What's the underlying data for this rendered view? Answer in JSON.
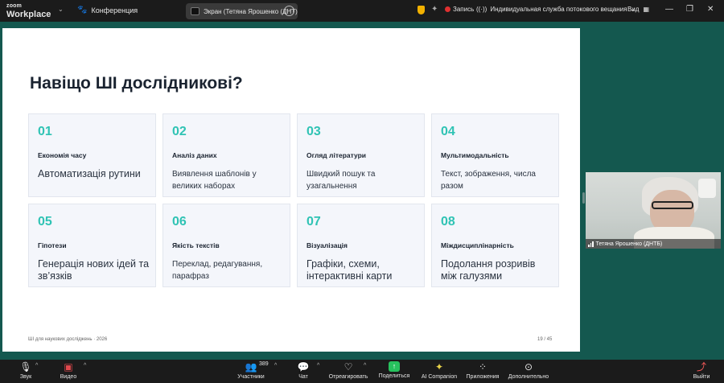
{
  "top_bar": {
    "brand_small": "zoom",
    "brand_large": "Workplace",
    "conference_label": "Конференция",
    "share_label": "Экран (Тетяна Ярошенко (ДНТ)",
    "record_label": "Запись",
    "stream_label": "Индивидуальная служба потокового вещания",
    "view_label": "Вид"
  },
  "slide": {
    "title": "Навіщо ШІ дослідникові?",
    "cards": [
      {
        "num": "01",
        "title": "Економія часу",
        "desc": "Автоматизація рутини",
        "size": "large"
      },
      {
        "num": "02",
        "title": "Аналіз даних",
        "desc": "Виявлення шаблонів у великих наборах",
        "size": "small"
      },
      {
        "num": "03",
        "title": "Огляд літератури",
        "desc": "Швидкий пошук та узагальнення",
        "size": "small"
      },
      {
        "num": "04",
        "title": "Мультимодальність",
        "desc": "Текст, зображення, числа разом",
        "size": "small"
      },
      {
        "num": "05",
        "title": "Гіпотези",
        "desc": "Генерація нових ідей та зв’язків",
        "size": "large"
      },
      {
        "num": "06",
        "title": "Якість текстів",
        "desc": "Переклад, редагування, парафраз",
        "size": "small"
      },
      {
        "num": "07",
        "title": "Візуалізація",
        "desc": "Графіки, схеми, інтерактивні карти",
        "size": "large"
      },
      {
        "num": "08",
        "title": "Міждисциплінарність",
        "desc": "Подолання розривів між галузями",
        "size": "large"
      }
    ],
    "footer_left": "ШІ для наукових досліджень · 2026",
    "footer_right": "19 / 45"
  },
  "participant": {
    "name": "Тетяна Ярошенко (ДНТБ)"
  },
  "toolbar": {
    "audio": "Звук",
    "video": "Видео",
    "participants": "Участники",
    "participants_count": "389",
    "chat": "Чат",
    "react": "Отреагировать",
    "share": "Поделиться",
    "companion": "AI Companion",
    "apps": "Приложения",
    "more": "Дополнительно",
    "leave": "Выйти"
  },
  "colors": {
    "accent_teal": "#2fc3b4",
    "stage_bg": "#14584f",
    "share_green": "#27c25d",
    "record_red": "#e03030"
  }
}
